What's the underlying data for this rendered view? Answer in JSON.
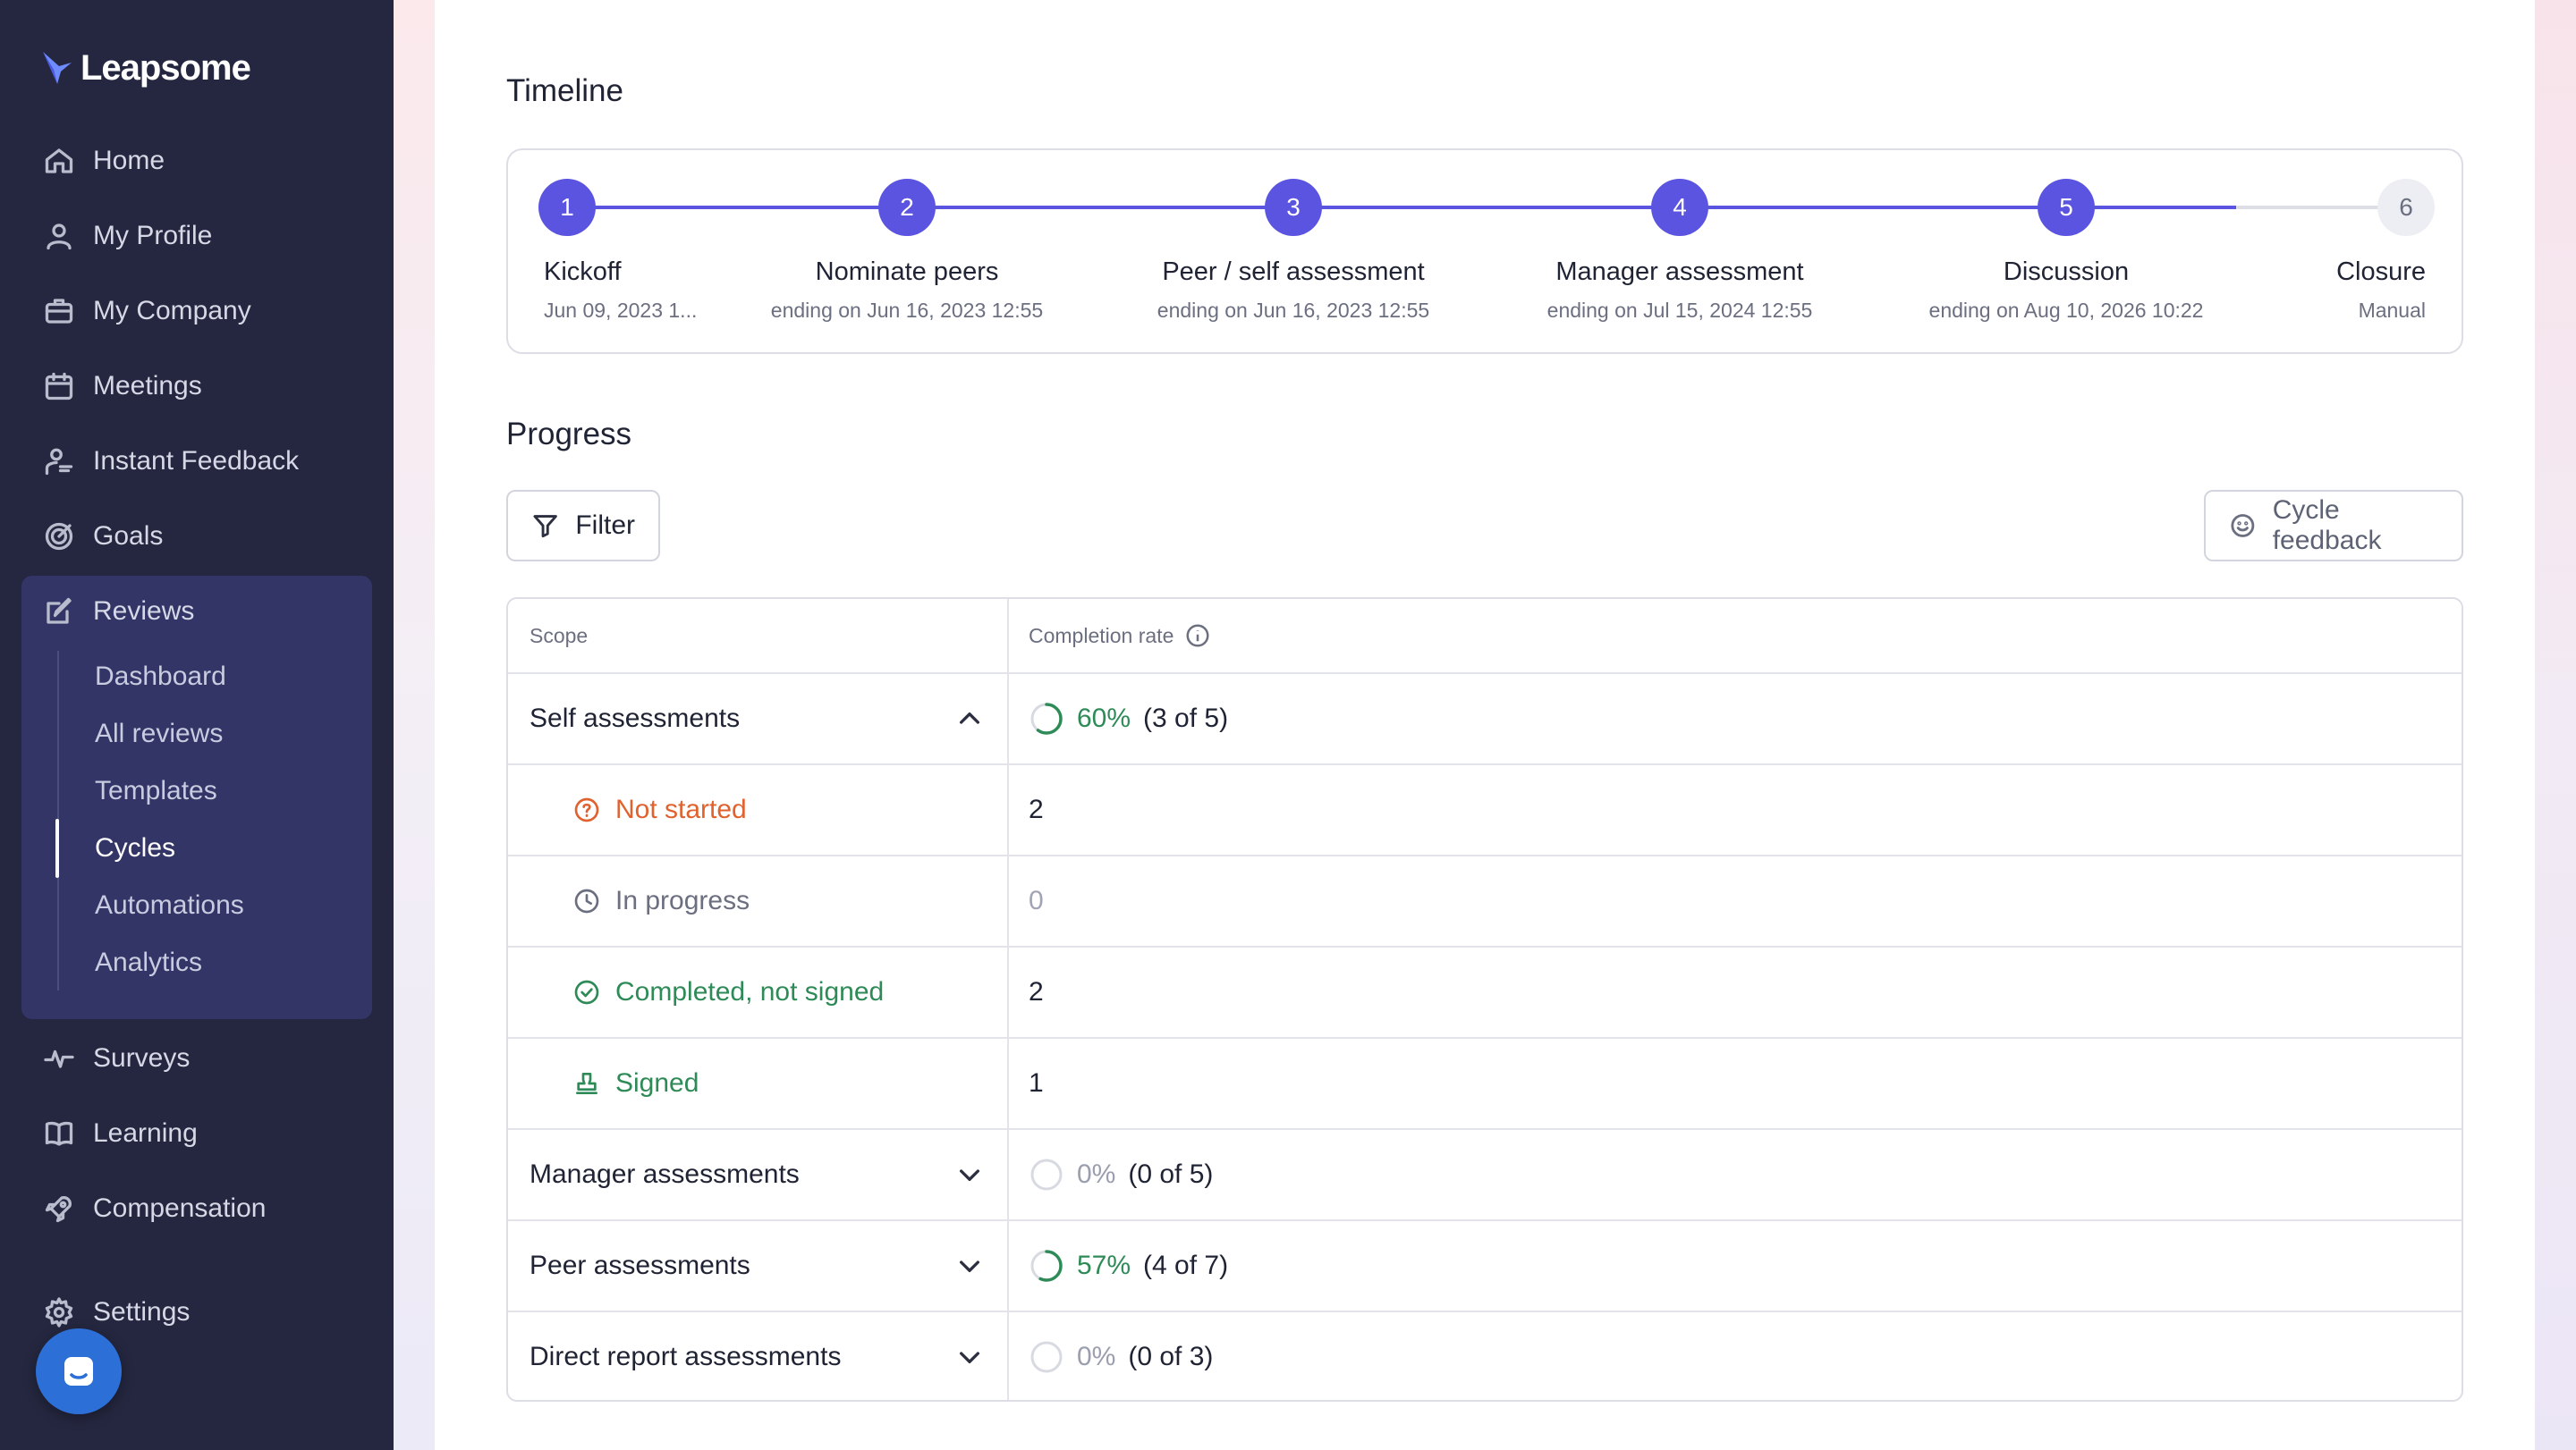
{
  "app": {
    "name": "Leapsome"
  },
  "sidebar": {
    "items": [
      {
        "label": "Home",
        "icon": "home-icon"
      },
      {
        "label": "My Profile",
        "icon": "user-icon"
      },
      {
        "label": "My Company",
        "icon": "briefcase-icon"
      },
      {
        "label": "Meetings",
        "icon": "calendar-icon"
      },
      {
        "label": "Instant Feedback",
        "icon": "feedback-icon"
      },
      {
        "label": "Goals",
        "icon": "target-icon"
      },
      {
        "label": "Reviews",
        "icon": "edit-icon"
      },
      {
        "label": "Surveys",
        "icon": "pulse-icon"
      },
      {
        "label": "Learning",
        "icon": "book-icon"
      },
      {
        "label": "Compensation",
        "icon": "rocket-icon"
      },
      {
        "label": "Settings",
        "icon": "gear-icon"
      }
    ],
    "reviews_sub": [
      {
        "label": "Dashboard"
      },
      {
        "label": "All reviews"
      },
      {
        "label": "Templates"
      },
      {
        "label": "Cycles",
        "active": true
      },
      {
        "label": "Automations"
      },
      {
        "label": "Analytics"
      }
    ]
  },
  "timeline": {
    "title": "Timeline",
    "steps": [
      {
        "number": "1",
        "name": "Kickoff",
        "sub": "Jun 09, 2023 1...",
        "done": true
      },
      {
        "number": "2",
        "name": "Nominate peers",
        "sub": "ending on Jun 16, 2023 12:55",
        "done": true
      },
      {
        "number": "3",
        "name": "Peer / self assessment",
        "sub": "ending on Jun 16, 2023 12:55",
        "done": true
      },
      {
        "number": "4",
        "name": "Manager assessment",
        "sub": "ending on Jul 15, 2024 12:55",
        "done": true
      },
      {
        "number": "5",
        "name": "Discussion",
        "sub": "ending on Aug 10, 2026 10:22",
        "done": true
      },
      {
        "number": "6",
        "name": "Closure",
        "sub": "Manual",
        "done": false
      }
    ]
  },
  "progress": {
    "title": "Progress",
    "filter_label": "Filter",
    "cycle_feedback_label": "Cycle feedback",
    "table": {
      "col_scope": "Scope",
      "col_rate": "Completion rate",
      "rows": [
        {
          "scope": "Self assessments",
          "pct": "60%",
          "count": "(3 of 5)",
          "fraction": 0.6,
          "expanded": true
        },
        {
          "scope": "Not started",
          "value": "2",
          "status": "not-started"
        },
        {
          "scope": "In progress",
          "value": "0",
          "status": "in-progress"
        },
        {
          "scope": "Completed, not signed",
          "value": "2",
          "status": "completed"
        },
        {
          "scope": "Signed",
          "value": "1",
          "status": "signed"
        },
        {
          "scope": "Manager assessments",
          "pct": "0%",
          "count": "(0 of 5)",
          "fraction": 0,
          "expanded": false
        },
        {
          "scope": "Peer assessments",
          "pct": "57%",
          "count": "(4 of 7)",
          "fraction": 0.57,
          "expanded": false
        },
        {
          "scope": "Direct report assessments",
          "pct": "0%",
          "count": "(0 of 3)",
          "fraction": 0,
          "expanded": false
        }
      ]
    }
  },
  "colors": {
    "sidebar_bg": "#252740",
    "accent": "#5b54e0",
    "success": "#2e8a57",
    "warning": "#e0622e"
  }
}
